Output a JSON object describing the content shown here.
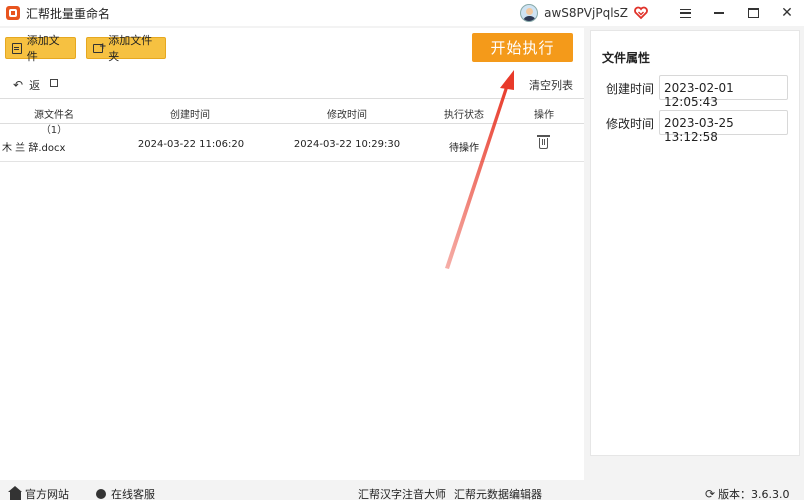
{
  "window": {
    "title": "汇帮批量重命名",
    "username": "awS8PVjPqlsZ"
  },
  "toolbar": {
    "add_file_label": "添加文件",
    "add_folder_label": "添加文件夹",
    "start_label": "开始执行",
    "back_label": "返",
    "clear_list_label": "清空列表"
  },
  "table": {
    "headers": [
      "源文件名（1）",
      "创建时间",
      "修改时间",
      "执行状态",
      "操作"
    ],
    "rows": [
      {
        "filename": "木 兰 辞.docx",
        "created": "2024-03-22 11:06:20",
        "modified": "2024-03-22 10:29:30",
        "status": "待操作"
      }
    ]
  },
  "properties": {
    "title": "文件属性",
    "created_label": "创建时间",
    "created_value": "2023-02-01 12:05:43",
    "modified_label": "修改时间",
    "modified_value": "2023-03-25 13:12:58"
  },
  "statusbar": {
    "website_label": "官方网站",
    "service_label": "在线客服",
    "app1_label": "汇帮汉字注音大师",
    "app2_label": "汇帮元数据编辑器",
    "version_label": "版本：3.6.3.0"
  },
  "colors": {
    "accent_orange": "#f49a1a",
    "button_yellow": "#f6c141",
    "arrow_red": "#e83a2a"
  }
}
